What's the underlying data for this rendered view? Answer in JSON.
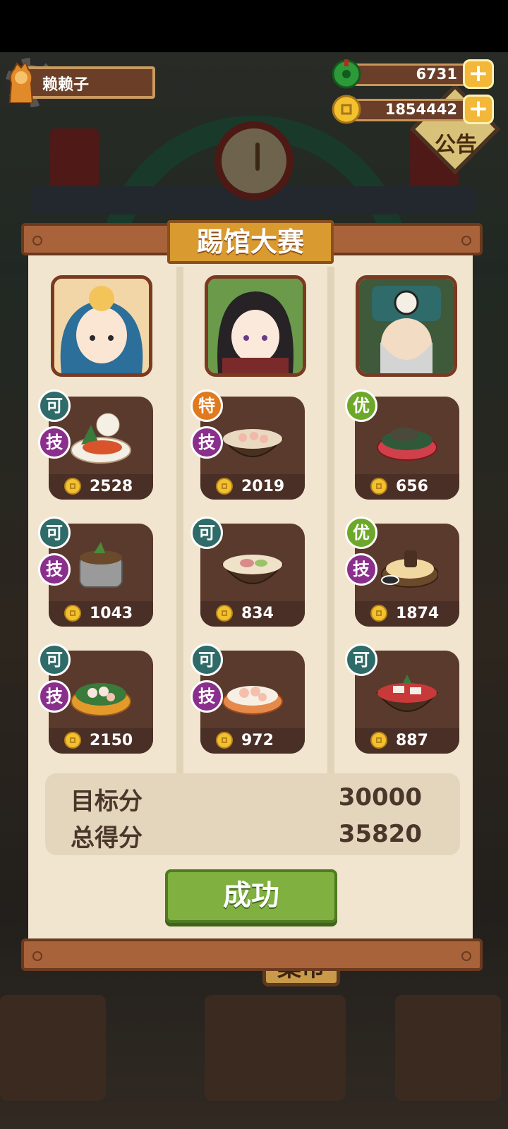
{
  "player": {
    "name": "赖赖子"
  },
  "currency": {
    "jade": "6731",
    "coins": "1854442"
  },
  "background": {
    "notice_label": "公告",
    "market_sign": "集市"
  },
  "panel": {
    "title": "踢馆大赛",
    "columns": [
      {
        "portrait": "blue-haired-opponent",
        "dishes": [
          {
            "grade": "可",
            "skill": "技",
            "score": "2528"
          },
          {
            "grade": "可",
            "skill": "技",
            "score": "1043"
          },
          {
            "grade": "可",
            "skill": "技",
            "score": "2150"
          }
        ]
      },
      {
        "portrait": "dark-haired-elf",
        "dishes": [
          {
            "grade": "特",
            "skill": "技",
            "score": "2019"
          },
          {
            "grade": "可",
            "skill": "",
            "score": "834"
          },
          {
            "grade": "可",
            "skill": "技",
            "score": "972"
          }
        ]
      },
      {
        "portrait": "taoist-elder",
        "dishes": [
          {
            "grade": "优",
            "skill": "",
            "score": "656"
          },
          {
            "grade": "优",
            "skill": "技",
            "score": "1874"
          },
          {
            "grade": "可",
            "skill": "",
            "score": "887"
          }
        ]
      }
    ],
    "target_label": "目标分",
    "target_value": "30000",
    "total_label": "总得分",
    "total_value": "35820",
    "result_button": "成功"
  },
  "colors": {
    "grade_ke": "#2f6b68",
    "grade_te": "#e07a1e",
    "grade_you": "#6ea82a",
    "skill": "#8a2f8c",
    "button": "#7fb040"
  }
}
